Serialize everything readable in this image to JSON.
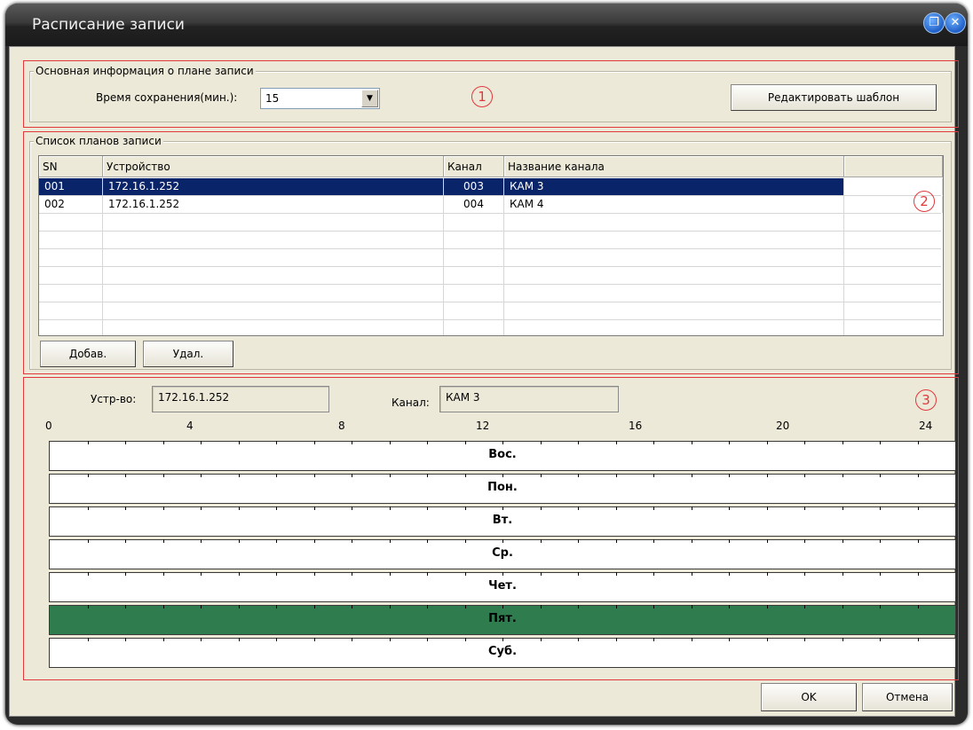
{
  "window": {
    "title": "Расписание записи"
  },
  "basic": {
    "group_label": "Основная информация о плане записи",
    "retention_label": "Время сохранения(мин.):",
    "retention_value": "15",
    "edit_template_label": "Редактировать шаблон",
    "marker": "1"
  },
  "plans": {
    "group_label": "Список планов записи",
    "marker": "2",
    "columns": [
      "SN",
      "Устройство",
      "Канал",
      "Название канала",
      ""
    ],
    "rows": [
      {
        "sn": "001",
        "device": "172.16.1.252",
        "channel": "003",
        "channel_name": "КАМ 3",
        "selected": true
      },
      {
        "sn": "002",
        "device": "172.16.1.252",
        "channel": "004",
        "channel_name": "КАМ 4",
        "selected": false
      }
    ],
    "add_label": "Добав.",
    "delete_label": "Удал."
  },
  "schedule": {
    "marker": "3",
    "device_label": "Устр-во:",
    "device_value": "172.16.1.252",
    "channel_label": "Канал:",
    "channel_value": "КАМ 3",
    "ruler": [
      "0",
      "4",
      "8",
      "12",
      "16",
      "20",
      "24"
    ],
    "days": [
      {
        "label": "Вос.",
        "active": false
      },
      {
        "label": "Пон.",
        "active": false
      },
      {
        "label": "Вт.",
        "active": false
      },
      {
        "label": "Ср.",
        "active": false
      },
      {
        "label": "Чет.",
        "active": false
      },
      {
        "label": "Пят.",
        "active": true
      },
      {
        "label": "Суб.",
        "active": false
      }
    ],
    "active_color": "#2f7d4e"
  },
  "footer": {
    "ok_label": "OK",
    "cancel_label": "Отмена"
  }
}
